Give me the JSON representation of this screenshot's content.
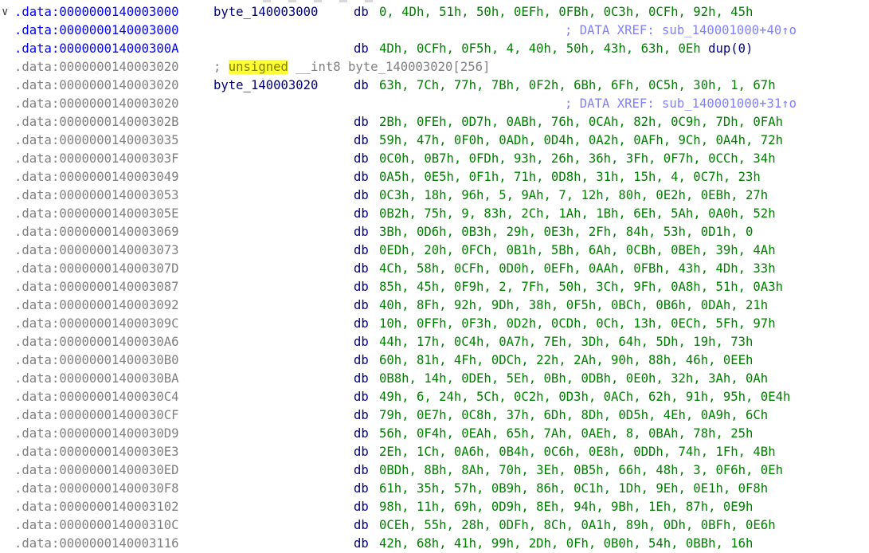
{
  "gutter_icon": "chevron-down-icon",
  "colors": {
    "current_address": "#0000ff",
    "address": "#808080",
    "label": "#000080",
    "mnemonic": "#000080",
    "operands": "#008000",
    "xref_comment": "#8080ff",
    "highlight": "#ffff33"
  },
  "lines": [
    {
      "addr": ".data:0000000140003000",
      "label": "byte_140003000",
      "mnem": "db",
      "ops": "0, 4Dh, 51h, 50h, 0EFh, 0FBh, 0C3h, 0CFh, 92h, 45h"
    },
    {
      "addr": ".data:0000000140003000",
      "xref": "; DATA XREF: sub_140001000+40↑o"
    },
    {
      "addr": ".data:000000014000300A",
      "mnem": "db",
      "ops": "4Dh, 0CFh, 0F5h, 4, 40h, 50h, 43h, 63h, 0Eh",
      "dup": "dup(0)"
    },
    {
      "addr": ".data:0000000140003020",
      "decl_prefix": "; ",
      "decl_keyword": "unsigned",
      "decl_rest": " __int8 byte_140003020[256]"
    },
    {
      "addr": ".data:0000000140003020",
      "label": "byte_140003020",
      "mnem": "db",
      "ops": "63h, 7Ch, 77h, 7Bh, 0F2h, 6Bh, 6Fh, 0C5h, 30h, 1, 67h"
    },
    {
      "addr": ".data:0000000140003020",
      "xref": "; DATA XREF: sub_140001000+31↑o"
    },
    {
      "addr": ".data:000000014000302B",
      "mnem": "db",
      "ops": "2Bh, 0FEh, 0D7h, 0ABh, 76h, 0CAh, 82h, 0C9h, 7Dh, 0FAh"
    },
    {
      "addr": ".data:0000000140003035",
      "mnem": "db",
      "ops": "59h, 47h, 0F0h, 0ADh, 0D4h, 0A2h, 0AFh, 9Ch, 0A4h, 72h"
    },
    {
      "addr": ".data:000000014000303F",
      "mnem": "db",
      "ops": "0C0h, 0B7h, 0FDh, 93h, 26h, 36h, 3Fh, 0F7h, 0CCh, 34h"
    },
    {
      "addr": ".data:0000000140003049",
      "mnem": "db",
      "ops": "0A5h, 0E5h, 0F1h, 71h, 0D8h, 31h, 15h, 4, 0C7h, 23h"
    },
    {
      "addr": ".data:0000000140003053",
      "mnem": "db",
      "ops": "0C3h, 18h, 96h, 5, 9Ah, 7, 12h, 80h, 0E2h, 0EBh, 27h"
    },
    {
      "addr": ".data:000000014000305E",
      "mnem": "db",
      "ops": "0B2h, 75h, 9, 83h, 2Ch, 1Ah, 1Bh, 6Eh, 5Ah, 0A0h, 52h"
    },
    {
      "addr": ".data:0000000140003069",
      "mnem": "db",
      "ops": "3Bh, 0D6h, 0B3h, 29h, 0E3h, 2Fh, 84h, 53h, 0D1h, 0"
    },
    {
      "addr": ".data:0000000140003073",
      "mnem": "db",
      "ops": "0EDh, 20h, 0FCh, 0B1h, 5Bh, 6Ah, 0CBh, 0BEh, 39h, 4Ah"
    },
    {
      "addr": ".data:000000014000307D",
      "mnem": "db",
      "ops": "4Ch, 58h, 0CFh, 0D0h, 0EFh, 0AAh, 0FBh, 43h, 4Dh, 33h"
    },
    {
      "addr": ".data:0000000140003087",
      "mnem": "db",
      "ops": "85h, 45h, 0F9h, 2, 7Fh, 50h, 3Ch, 9Fh, 0A8h, 51h, 0A3h"
    },
    {
      "addr": ".data:0000000140003092",
      "mnem": "db",
      "ops": "40h, 8Fh, 92h, 9Dh, 38h, 0F5h, 0BCh, 0B6h, 0DAh, 21h"
    },
    {
      "addr": ".data:000000014000309C",
      "mnem": "db",
      "ops": "10h, 0FFh, 0F3h, 0D2h, 0CDh, 0Ch, 13h, 0ECh, 5Fh, 97h"
    },
    {
      "addr": ".data:00000001400030A6",
      "mnem": "db",
      "ops": "44h, 17h, 0C4h, 0A7h, 7Eh, 3Dh, 64h, 5Dh, 19h, 73h"
    },
    {
      "addr": ".data:00000001400030B0",
      "mnem": "db",
      "ops": "60h, 81h, 4Fh, 0DCh, 22h, 2Ah, 90h, 88h, 46h, 0EEh"
    },
    {
      "addr": ".data:00000001400030BA",
      "mnem": "db",
      "ops": "0B8h, 14h, 0DEh, 5Eh, 0Bh, 0DBh, 0E0h, 32h, 3Ah, 0Ah"
    },
    {
      "addr": ".data:00000001400030C4",
      "mnem": "db",
      "ops": "49h, 6, 24h, 5Ch, 0C2h, 0D3h, 0ACh, 62h, 91h, 95h, 0E4h"
    },
    {
      "addr": ".data:00000001400030CF",
      "mnem": "db",
      "ops": "79h, 0E7h, 0C8h, 37h, 6Dh, 8Dh, 0D5h, 4Eh, 0A9h, 6Ch"
    },
    {
      "addr": ".data:00000001400030D9",
      "mnem": "db",
      "ops": "56h, 0F4h, 0EAh, 65h, 7Ah, 0AEh, 8, 0BAh, 78h, 25h"
    },
    {
      "addr": ".data:00000001400030E3",
      "mnem": "db",
      "ops": "2Eh, 1Ch, 0A6h, 0B4h, 0C6h, 0E8h, 0DDh, 74h, 1Fh, 4Bh"
    },
    {
      "addr": ".data:00000001400030ED",
      "mnem": "db",
      "ops": "0BDh, 8Bh, 8Ah, 70h, 3Eh, 0B5h, 66h, 48h, 3, 0F6h, 0Eh"
    },
    {
      "addr": ".data:00000001400030F8",
      "mnem": "db",
      "ops": "61h, 35h, 57h, 0B9h, 86h, 0C1h, 1Dh, 9Eh, 0E1h, 0F8h"
    },
    {
      "addr": ".data:0000000140003102",
      "mnem": "db",
      "ops": "98h, 11h, 69h, 0D9h, 8Eh, 94h, 9Bh, 1Eh, 87h, 0E9h"
    },
    {
      "addr": ".data:000000014000310C",
      "mnem": "db",
      "ops": "0CEh, 55h, 28h, 0DFh, 8Ch, 0A1h, 89h, 0Dh, 0BFh, 0E6h"
    },
    {
      "addr": ".data:0000000140003116",
      "mnem": "db",
      "ops": "42h, 68h, 41h, 99h, 2Dh, 0Fh, 0B0h, 54h, 0BBh, 16h"
    }
  ]
}
